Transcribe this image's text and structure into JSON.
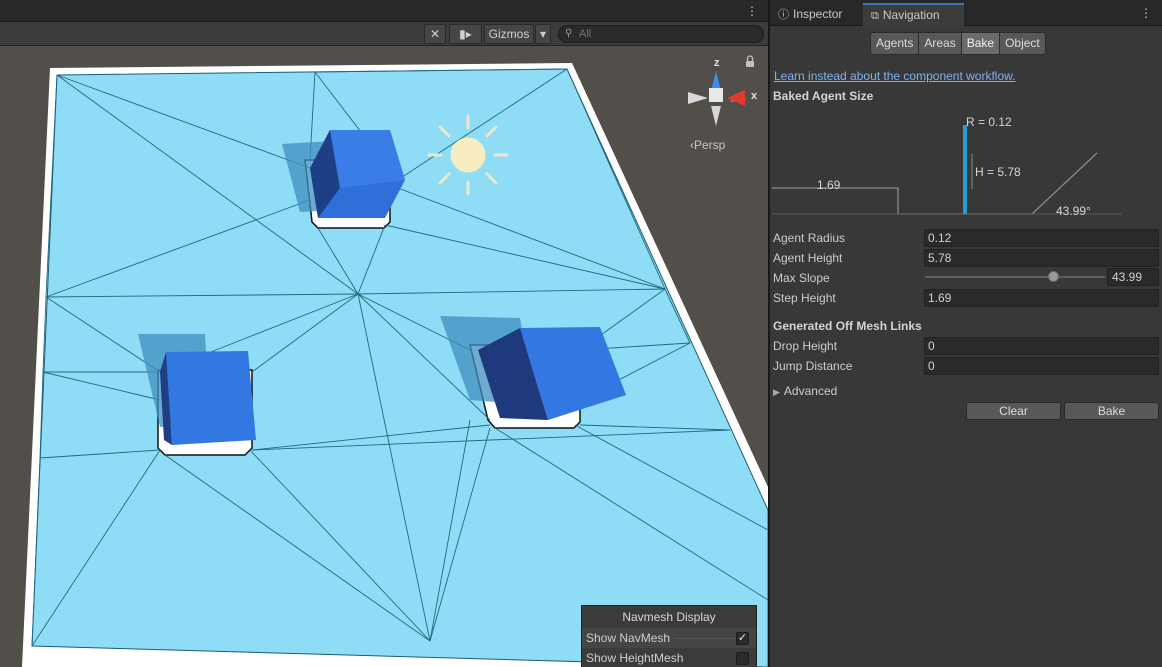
{
  "scene": {
    "toolbar": {
      "gizmos_label": "Gizmos"
    },
    "search": {
      "placeholder": "All"
    },
    "gizmo": {
      "y_axis": "z",
      "x_axis": "x",
      "projection_label": "‹Persp"
    }
  },
  "navmesh_display": {
    "title": "Navmesh Display",
    "show_navmesh": {
      "label": "Show NavMesh",
      "checked": true
    },
    "show_heightmesh": {
      "label": "Show HeightMesh",
      "checked": false
    }
  },
  "right_panel": {
    "tabs": [
      {
        "label": "Inspector",
        "icon": "info-icon"
      },
      {
        "label": "Navigation",
        "icon": "navigation-icon",
        "active": true
      }
    ],
    "modes": [
      "Agents",
      "Areas",
      "Bake",
      "Object"
    ],
    "selected_mode": "Bake",
    "workflow_link": "Learn instead about the component workflow.",
    "baked_agent_size": {
      "heading": "Baked Agent Size",
      "radius_label": "R = 0.12",
      "height_label": "H = 5.78",
      "step_label": "1.69",
      "slope_label": "43.99°"
    },
    "fields": {
      "agent_radius": {
        "label": "Agent Radius",
        "value": "0.12"
      },
      "agent_height": {
        "label": "Agent Height",
        "value": "5.78"
      },
      "max_slope": {
        "label": "Max Slope",
        "value": "43.99"
      },
      "step_height": {
        "label": "Step Height",
        "value": "1.69"
      }
    },
    "off_mesh_links": {
      "heading": "Generated Off Mesh Links",
      "drop_height": {
        "label": "Drop Height",
        "value": "0"
      },
      "jump_distance": {
        "label": "Jump Distance",
        "value": "0"
      }
    },
    "advanced_label": "Advanced",
    "buttons": {
      "clear": "Clear",
      "bake": "Bake"
    }
  },
  "colors": {
    "navmesh": "#8fdcf7",
    "cube_face": "#2f6fd9",
    "link": "#7fb1ee",
    "tab_accent": "#3a79bb",
    "agent_bar": "#2a9ad6"
  }
}
